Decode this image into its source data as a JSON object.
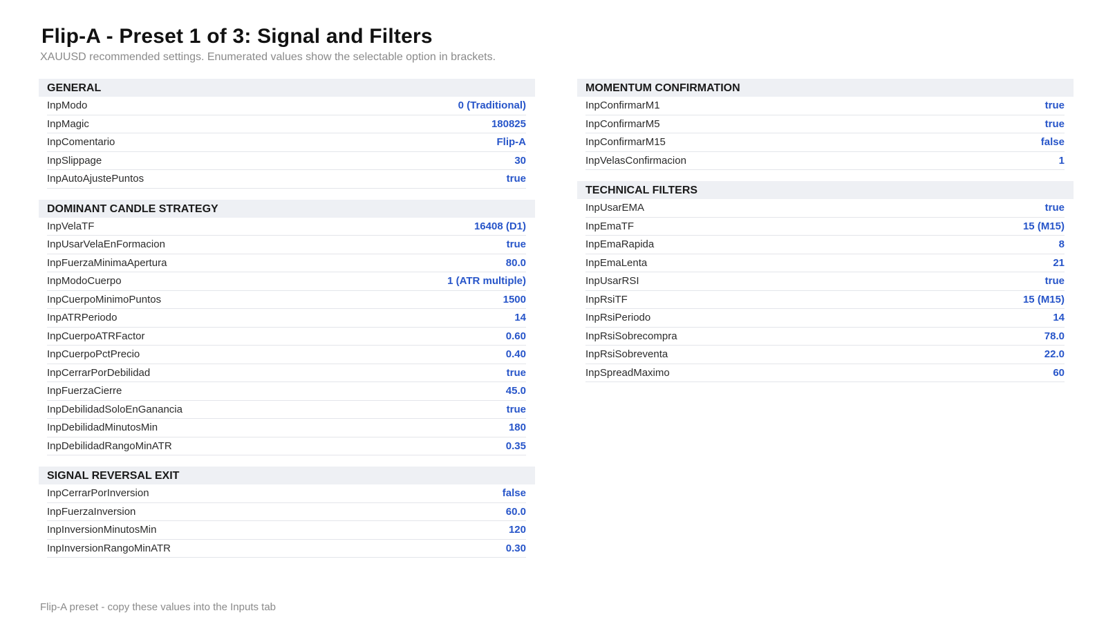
{
  "header": {
    "title": "Flip-A - Preset 1 of 3: Signal and Filters",
    "subtitle": "XAUUSD recommended settings. Enumerated values show the selectable option in brackets."
  },
  "columns": {
    "left": [
      {
        "title": "GENERAL",
        "rows": [
          {
            "label": "InpModo",
            "value": "0  (Traditional)"
          },
          {
            "label": "InpMagic",
            "value": "180825"
          },
          {
            "label": "InpComentario",
            "value": "Flip-A"
          },
          {
            "label": "InpSlippage",
            "value": "30"
          },
          {
            "label": "InpAutoAjustePuntos",
            "value": "true"
          }
        ]
      },
      {
        "title": "DOMINANT CANDLE STRATEGY",
        "rows": [
          {
            "label": "InpVelaTF",
            "value": "16408  (D1)"
          },
          {
            "label": "InpUsarVelaEnFormacion",
            "value": "true"
          },
          {
            "label": "InpFuerzaMinimaApertura",
            "value": "80.0"
          },
          {
            "label": "InpModoCuerpo",
            "value": "1  (ATR multiple)"
          },
          {
            "label": "InpCuerpoMinimoPuntos",
            "value": "1500"
          },
          {
            "label": "InpATRPeriodo",
            "value": "14"
          },
          {
            "label": "InpCuerpoATRFactor",
            "value": "0.60"
          },
          {
            "label": "InpCuerpoPctPrecio",
            "value": "0.40"
          },
          {
            "label": "InpCerrarPorDebilidad",
            "value": "true"
          },
          {
            "label": "InpFuerzaCierre",
            "value": "45.0"
          },
          {
            "label": "InpDebilidadSoloEnGanancia",
            "value": "true"
          },
          {
            "label": "InpDebilidadMinutosMin",
            "value": "180"
          },
          {
            "label": "InpDebilidadRangoMinATR",
            "value": "0.35"
          }
        ]
      },
      {
        "title": "SIGNAL REVERSAL EXIT",
        "rows": [
          {
            "label": "InpCerrarPorInversion",
            "value": "false"
          },
          {
            "label": "InpFuerzaInversion",
            "value": "60.0"
          },
          {
            "label": "InpInversionMinutosMin",
            "value": "120"
          },
          {
            "label": "InpInversionRangoMinATR",
            "value": "0.30"
          }
        ]
      }
    ],
    "right": [
      {
        "title": "MOMENTUM CONFIRMATION",
        "rows": [
          {
            "label": "InpConfirmarM1",
            "value": "true"
          },
          {
            "label": "InpConfirmarM5",
            "value": "true"
          },
          {
            "label": "InpConfirmarM15",
            "value": "false"
          },
          {
            "label": "InpVelasConfirmacion",
            "value": "1"
          }
        ]
      },
      {
        "title": "TECHNICAL FILTERS",
        "rows": [
          {
            "label": "InpUsarEMA",
            "value": "true"
          },
          {
            "label": "InpEmaTF",
            "value": "15  (M15)"
          },
          {
            "label": "InpEmaRapida",
            "value": "8"
          },
          {
            "label": "InpEmaLenta",
            "value": "21"
          },
          {
            "label": "InpUsarRSI",
            "value": "true"
          },
          {
            "label": "InpRsiTF",
            "value": "15  (M15)"
          },
          {
            "label": "InpRsiPeriodo",
            "value": "14"
          },
          {
            "label": "InpRsiSobrecompra",
            "value": "78.0"
          },
          {
            "label": "InpRsiSobreventa",
            "value": "22.0"
          },
          {
            "label": "InpSpreadMaximo",
            "value": "60"
          }
        ]
      }
    ]
  },
  "footer": {
    "text": "Flip-A preset - copy these values into the Inputs tab"
  },
  "colors": {
    "value": "#2755c9",
    "section_bg": "#eef0f4",
    "muted_text": "#8a8a8a"
  }
}
